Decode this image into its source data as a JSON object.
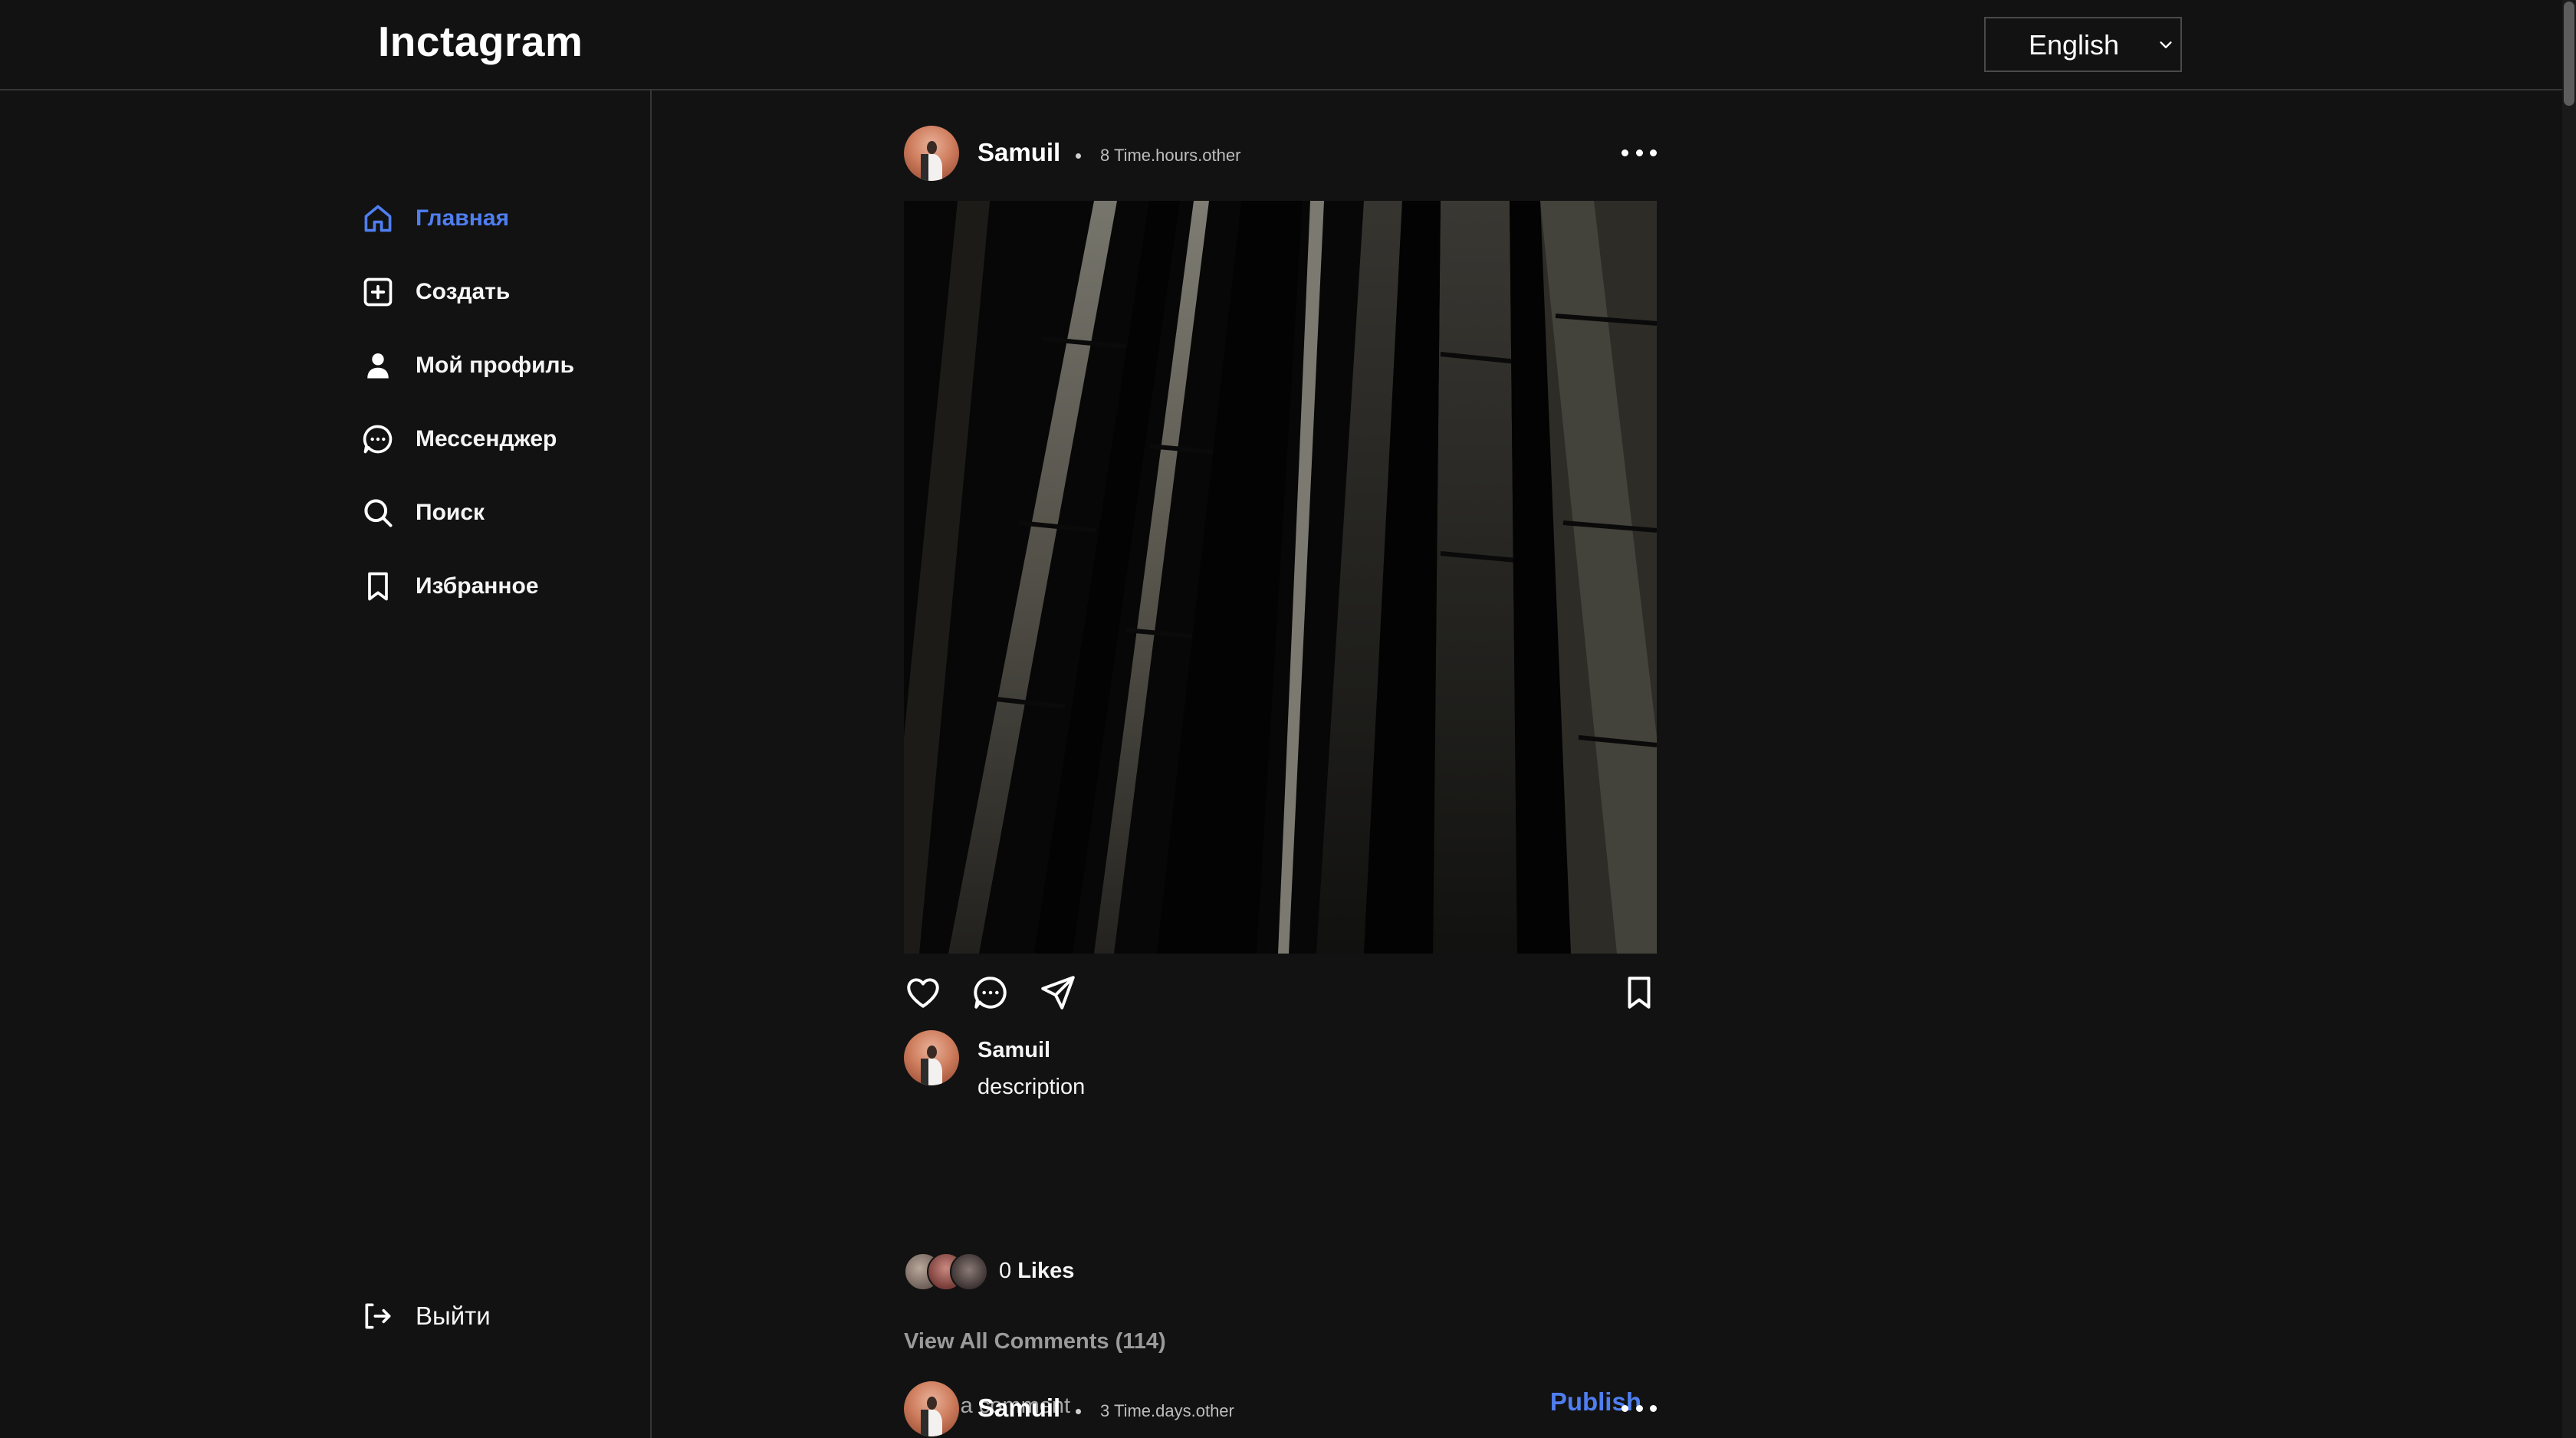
{
  "app": {
    "logo": "Inctagram"
  },
  "language_select": {
    "value": "English",
    "icon": "chevron-down-icon"
  },
  "sidebar": {
    "items": [
      {
        "label": "Главная",
        "icon": "home-icon",
        "active": true
      },
      {
        "label": "Создать",
        "icon": "plus-square-icon",
        "active": false
      },
      {
        "label": "Мой профиль",
        "icon": "person-icon",
        "active": false
      },
      {
        "label": "Мессенджер",
        "icon": "message-circle-icon",
        "active": false
      },
      {
        "label": "Поиск",
        "icon": "search-icon",
        "active": false
      },
      {
        "label": "Избранное",
        "icon": "bookmark-icon",
        "active": false
      }
    ],
    "logout": {
      "label": "Выйти",
      "icon": "log-out-icon"
    }
  },
  "colors": {
    "background": "#121212",
    "accent": "#4f7ef0",
    "border": "#363636",
    "muted": "#9a9a9a"
  },
  "feed": {
    "posts": [
      {
        "username": "Samuil",
        "time": "8 Time.hours.other",
        "caption_user": "Samuil",
        "description": "description",
        "likes_count": "0",
        "likes_label": "Likes",
        "view_comments": "View All Comments (114)",
        "comment_placeholder": "Add a comment",
        "publish_label": "Publish"
      },
      {
        "username": "Samuil",
        "time": "3 Time.days.other"
      }
    ]
  }
}
